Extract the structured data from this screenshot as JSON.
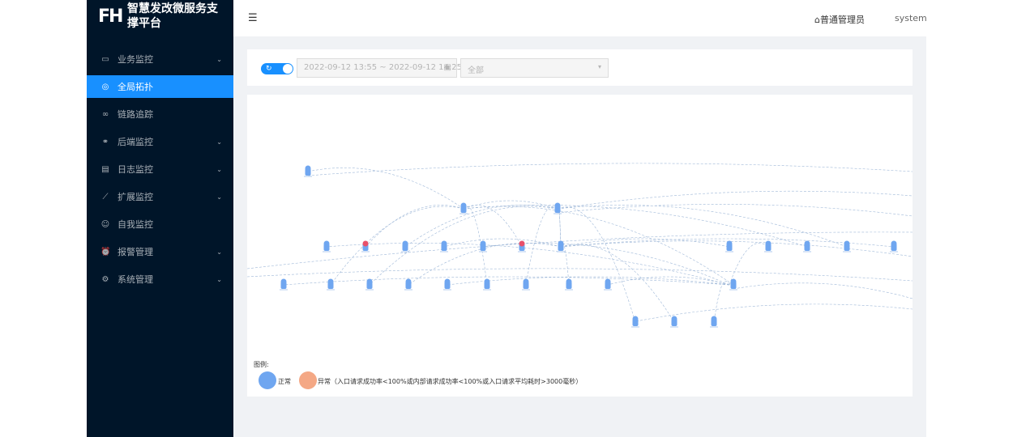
{
  "app": {
    "logo_mark": "FH",
    "title": "智慧发改微服务支撑平台"
  },
  "sidebar": {
    "items": [
      {
        "label": "业务监控",
        "icon": "monitor-icon",
        "active": false,
        "has_children": true
      },
      {
        "label": "全局拓扑",
        "icon": "globe-icon",
        "active": true,
        "has_children": false
      },
      {
        "label": "链路追踪",
        "icon": "link-icon",
        "active": false,
        "has_children": false
      },
      {
        "label": "后端监控",
        "icon": "chain-icon",
        "active": false,
        "has_children": true
      },
      {
        "label": "日志监控",
        "icon": "log-icon",
        "active": false,
        "has_children": true
      },
      {
        "label": "扩展监控",
        "icon": "chart-line-icon",
        "active": false,
        "has_children": true
      },
      {
        "label": "自我监控",
        "icon": "smile-icon",
        "active": false,
        "has_children": false
      },
      {
        "label": "报警管理",
        "icon": "alarm-icon",
        "active": false,
        "has_children": true
      },
      {
        "label": "系统管理",
        "icon": "gear-icon",
        "active": false,
        "has_children": true
      }
    ]
  },
  "header": {
    "collapse_icon": "menu-fold-icon",
    "user_role": "普通管理员",
    "username": "system"
  },
  "filter": {
    "date_range": "2022-09-12 13:55 ~ 2022-09-12 14:25",
    "select_value": "全部",
    "auto_refresh": true
  },
  "legend": {
    "title": "图例:",
    "normal_label": "正常",
    "abnormal_label": "异常（入口请求成功率<100%或内部请求成功率<100%或入口请求平均耗时>3000毫秒）",
    "normal_color": "#6fa6f0",
    "abnormal_color": "#f4a885"
  },
  "colors": {
    "accent": "#1890ff",
    "sidebar_bg": "#001529",
    "node": "#6fa6f0",
    "node_alert": "#e8506a",
    "edge": "#9fb8d8"
  }
}
